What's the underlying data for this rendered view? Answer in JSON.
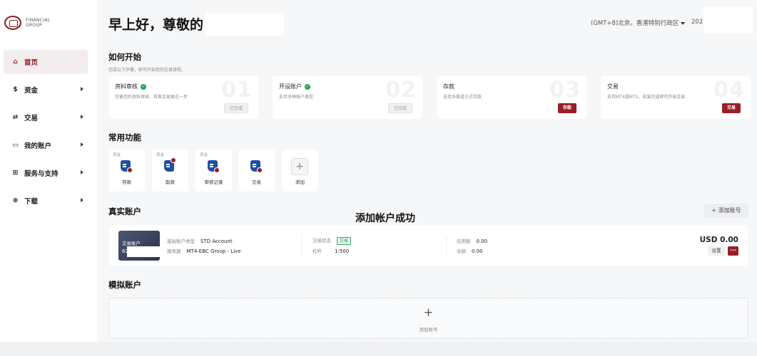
{
  "brand": {
    "line1": "FINANCIAL",
    "line2": "GROUP",
    "color": "#8c1d24"
  },
  "sidebar": {
    "items": [
      {
        "label": "首页",
        "icon": "home-icon",
        "glyph": "⌂",
        "active": true,
        "arrow": false
      },
      {
        "label": "资金",
        "icon": "dollar-circle-icon",
        "glyph": "$",
        "active": false,
        "arrow": true
      },
      {
        "label": "交易",
        "icon": "trade-icon",
        "glyph": "⇄",
        "active": false,
        "arrow": true
      },
      {
        "label": "我的账户",
        "icon": "folder-icon",
        "glyph": "▭",
        "active": false,
        "arrow": true
      },
      {
        "label": "服务与支持",
        "icon": "grid-icon",
        "glyph": "⊞",
        "active": false,
        "arrow": true
      },
      {
        "label": "下载",
        "icon": "download-icon",
        "glyph": "⊕",
        "active": false,
        "arrow": true
      }
    ]
  },
  "header": {
    "greeting": "早上好，尊敬的",
    "timezone": "(GMT+8)北京，香港特别行政区",
    "year": "2023"
  },
  "getting_started": {
    "title": "如何开始",
    "subtitle": "完成以下步骤，即可开启您的交易旅程。",
    "steps": [
      {
        "num": "01",
        "title": "资料审核",
        "done": true,
        "desc": "完善您的资料审核，将离交易更近一步",
        "tag": "已完成"
      },
      {
        "num": "02",
        "title": "开设账户",
        "done": true,
        "desc": "支持多种账户类型",
        "tag": "已完成"
      },
      {
        "num": "03",
        "title": "存款",
        "done": false,
        "desc": "支持多渠道方式存款",
        "tag": "存款"
      },
      {
        "num": "04",
        "title": "交易",
        "done": false,
        "desc": "支持MT4或MT5，安装完成即可开始交易",
        "tag": "交易"
      }
    ]
  },
  "functions": {
    "title": "常用功能",
    "items": [
      {
        "tag": "资金",
        "label": "存款"
      },
      {
        "tag": "资金",
        "label": "取款"
      },
      {
        "tag": "资金",
        "label": "审核记录"
      },
      {
        "tag": "",
        "label": "交易"
      },
      {
        "tag": "",
        "label": "添加"
      }
    ]
  },
  "toast": {
    "message": "添加帐户成功"
  },
  "real_accounts": {
    "title": "真实账户",
    "add_button": "+ 添加账号",
    "account": {
      "thumb_label": "交易账户",
      "thumb_num": "62",
      "type_label": "基础账户类型",
      "type_value": "STD Account",
      "server_label": "服务器",
      "server_value": "MT4-EBC Group - Live",
      "status_label": "交易状态",
      "status_value": "交易",
      "leverage_label": "杠杆",
      "leverage_value": "1:500",
      "credit_label": "信用额",
      "credit_value": "0.00",
      "balance_label": "余额",
      "balance_value": "0.00",
      "total": "USD 0.00",
      "settings": "设置",
      "more": "···"
    }
  },
  "demo_accounts": {
    "title": "模拟账户",
    "plus": "+",
    "add_label": "添加账号"
  },
  "colors": {
    "accent": "#9a1e26",
    "success": "#23a455",
    "icon_blue": "#1d4fa3"
  }
}
